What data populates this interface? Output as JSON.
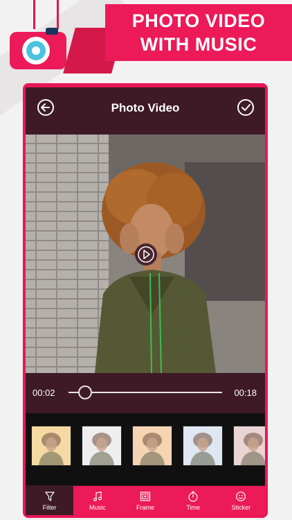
{
  "banner": {
    "line1": "PHOTO VIDEO",
    "line2": "WITH MUSIC"
  },
  "app": {
    "title": "Photo Video",
    "time_current": "00:02",
    "time_total": "00:18",
    "progress": 0.11
  },
  "tabs": [
    {
      "label": "Filter",
      "icon": "filter-icon",
      "active": true
    },
    {
      "label": "Music",
      "icon": "music-icon",
      "active": false
    },
    {
      "label": "Frame",
      "icon": "frame-icon",
      "active": false
    },
    {
      "label": "Time",
      "icon": "timer-icon",
      "active": false
    },
    {
      "label": "Sticker",
      "icon": "sticker-icon",
      "active": false
    }
  ],
  "colors": {
    "accent": "#ec1a58",
    "dark": "#3e1a27"
  }
}
